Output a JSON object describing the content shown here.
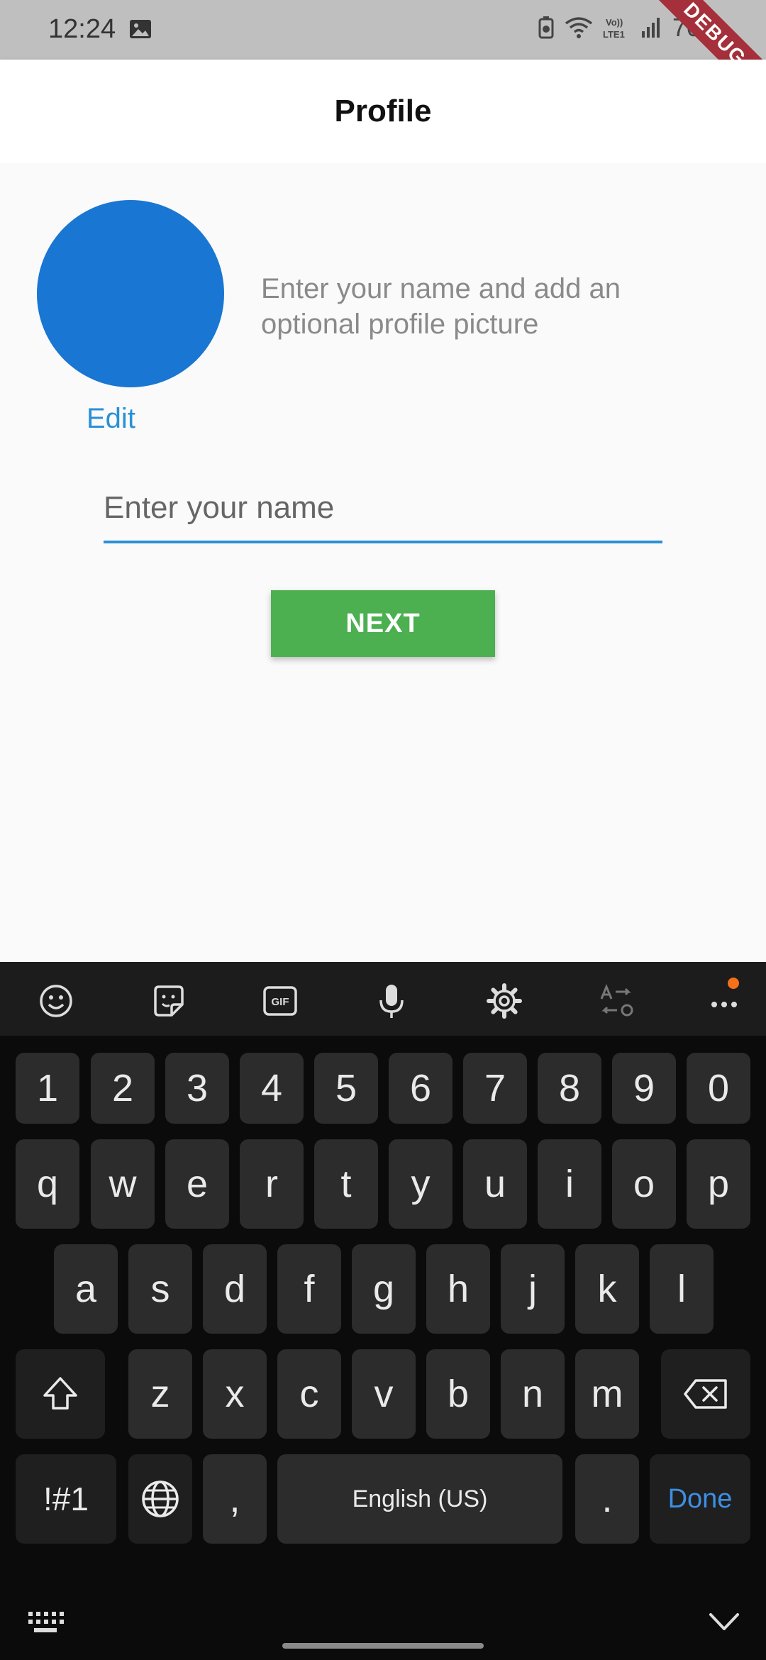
{
  "status_bar": {
    "time": "12:24",
    "battery": "70%",
    "debug_banner": "DEBUG"
  },
  "app_bar": {
    "title": "Profile"
  },
  "profile": {
    "avatar_color": "#1976d2",
    "edit_label": "Edit",
    "hint": "Enter your name and add an optional profile picture",
    "name_placeholder": "Enter your name",
    "name_value": "",
    "next_label": "NEXT"
  },
  "keyboard": {
    "toolbar_icons": [
      "emoji-icon",
      "sticker-icon",
      "gif-icon",
      "microphone-icon",
      "settings-icon",
      "translate-icon",
      "more-icon"
    ],
    "gif_label": "GIF",
    "number_row": [
      "1",
      "2",
      "3",
      "4",
      "5",
      "6",
      "7",
      "8",
      "9",
      "0"
    ],
    "row1": [
      "q",
      "w",
      "e",
      "r",
      "t",
      "y",
      "u",
      "i",
      "o",
      "p"
    ],
    "row2": [
      "a",
      "s",
      "d",
      "f",
      "g",
      "h",
      "j",
      "k",
      "l"
    ],
    "row3": [
      "z",
      "x",
      "c",
      "v",
      "b",
      "n",
      "m"
    ],
    "symbols_label": "!#1",
    "comma": ",",
    "space_label": "English (US)",
    "period": ".",
    "done_label": "Done"
  }
}
